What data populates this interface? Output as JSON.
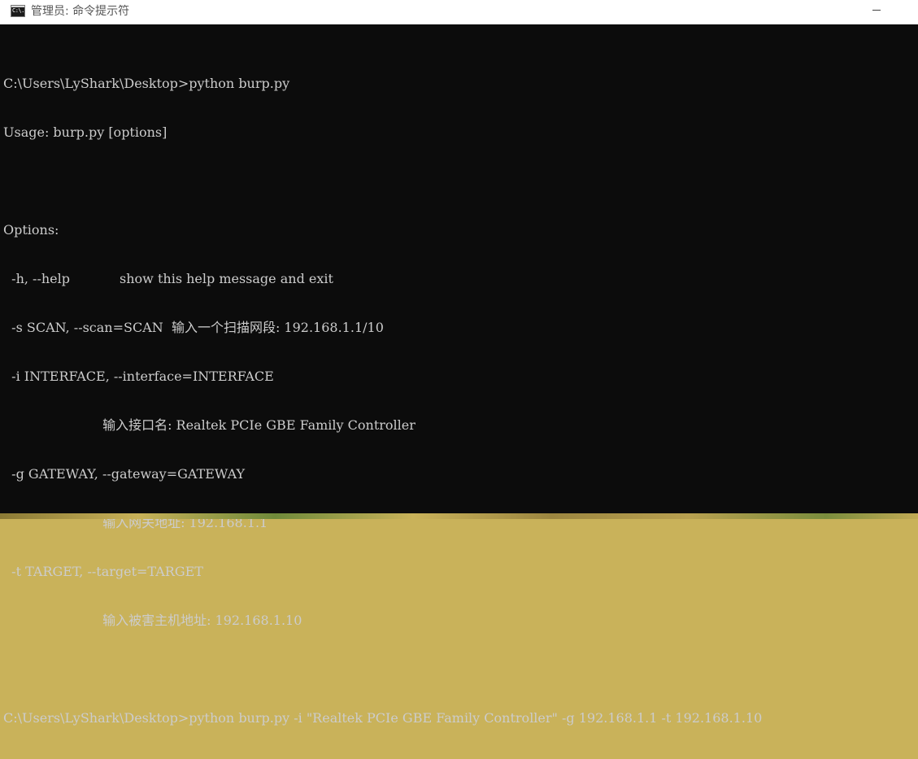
{
  "window": {
    "title": "管理员: 命令提示符",
    "icon": "cmd-icon",
    "icon_text": "C:\\."
  },
  "console": {
    "lines": [
      "C:\\Users\\LyShark\\Desktop>python burp.py",
      "Usage: burp.py [options]",
      "",
      "Options:",
      "  -h, --help            show this help message and exit",
      "  -s SCAN, --scan=SCAN  输入一个扫描网段: 192.168.1.1/10",
      "  -i INTERFACE, --interface=INTERFACE",
      "                        输入接口名: Realtek PCIe GBE Family Controller",
      "  -g GATEWAY, --gateway=GATEWAY",
      "                        输入网关地址: 192.168.1.1",
      "  -t TARGET, --target=TARGET",
      "                        输入被害主机地址: 192.168.1.10",
      "",
      "C:\\Users\\LyShark\\Desktop>python burp.py -i \"Realtek PCIe GBE Family Controller\" -g 192.168.1.1 -t 192.168.1.10"
    ]
  },
  "colors": {
    "console_bg": "#0c0c0c",
    "console_fg": "#cccccc",
    "titlebar_bg": "#ffffff"
  }
}
